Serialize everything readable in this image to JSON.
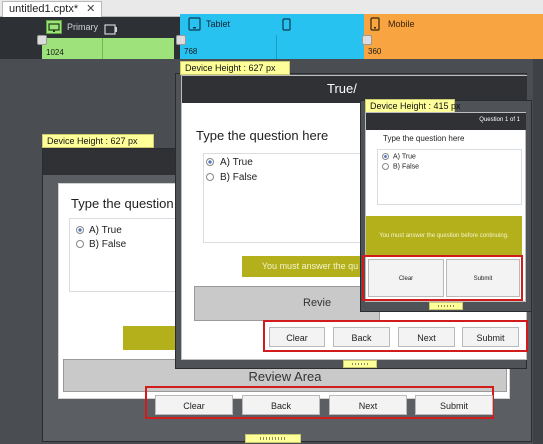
{
  "tab": {
    "title": "untitled1.cptx*",
    "close": "✕"
  },
  "breakpoints": {
    "primary": {
      "name": "Primary",
      "width": "1024",
      "color": "#9de27a"
    },
    "tablet": {
      "name": "Tablet",
      "width": "768",
      "color": "#27c2f0"
    },
    "mobile": {
      "name": "Mobile",
      "width": "360",
      "color": "#f7a441"
    }
  },
  "primary_view": {
    "device_height": "Device Height : 627 px",
    "question": "Type the question",
    "options": [
      "A)  True",
      "B)  False"
    ],
    "review": "Review Area",
    "buttons": [
      "Clear",
      "Back",
      "Next",
      "Submit"
    ]
  },
  "tablet_view": {
    "device_height": "Device Height : 627 px",
    "title": "True/",
    "question": "Type the question here",
    "options": [
      "A)  True",
      "B)  False"
    ],
    "message": "You must answer the qu",
    "review": "Revie",
    "buttons": [
      "Clear",
      "Back",
      "Next",
      "Submit"
    ]
  },
  "mobile_view": {
    "device_height": "Device Height : 415 px",
    "progress": "Question 1 of 1",
    "question": "Type the question here",
    "options": [
      "A)  True",
      "B)  False"
    ],
    "message": "You must answer the question before continuing.",
    "buttons": [
      "Clear",
      "Submit"
    ]
  }
}
